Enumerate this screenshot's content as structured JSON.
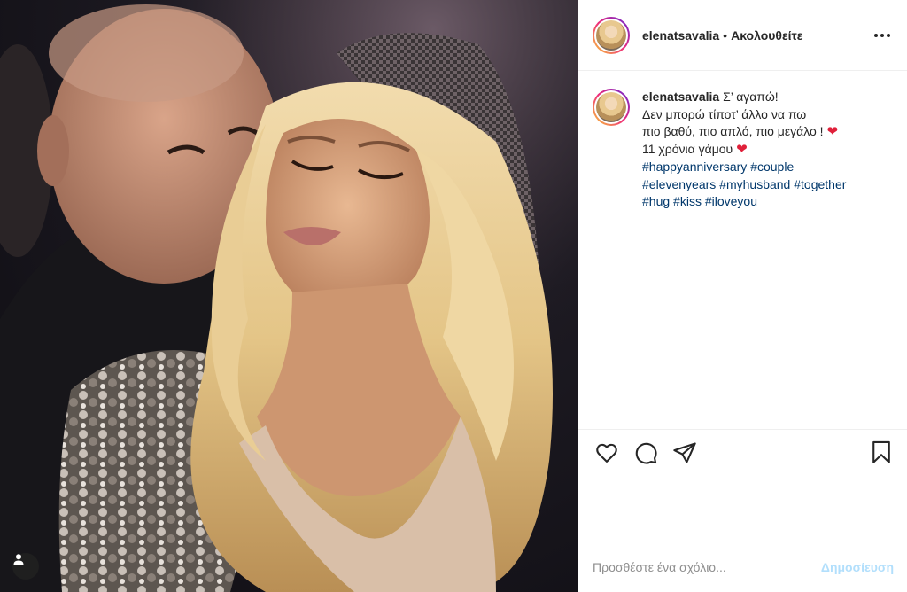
{
  "post": {
    "author": "elenatsavalia",
    "separator": "•",
    "follow_label": "Ακολουθείτε"
  },
  "caption": {
    "username": "elenatsavalia",
    "line1": "Σ’ αγαπώ!",
    "line2": "Δεν μπορώ τίποτ’ άλλο να πω",
    "line3": "πιο βαθύ, πιο απλό, πιο μεγάλο !",
    "line4": "11 χρόνια γάμου",
    "heart": "❤",
    "hashtags": [
      "#happyanniversary",
      "#couple",
      "#elevenyears",
      "#myhusband",
      "#together",
      "#hug",
      "#kiss",
      "#iloveyou"
    ]
  },
  "actions": {
    "like_icon": "heart-outline-icon",
    "comment_icon": "comment-bubble-icon",
    "share_icon": "paper-plane-icon",
    "save_icon": "bookmark-icon"
  },
  "comment_box": {
    "placeholder": "Προσθέστε ένα σχόλιο...",
    "post_label": "Δημοσίευση"
  },
  "colors": {
    "text": "#262626",
    "hashtag": "#00376b",
    "post_disabled": "#b2dffc",
    "heart": "#e0203a",
    "border": "#efefef"
  }
}
